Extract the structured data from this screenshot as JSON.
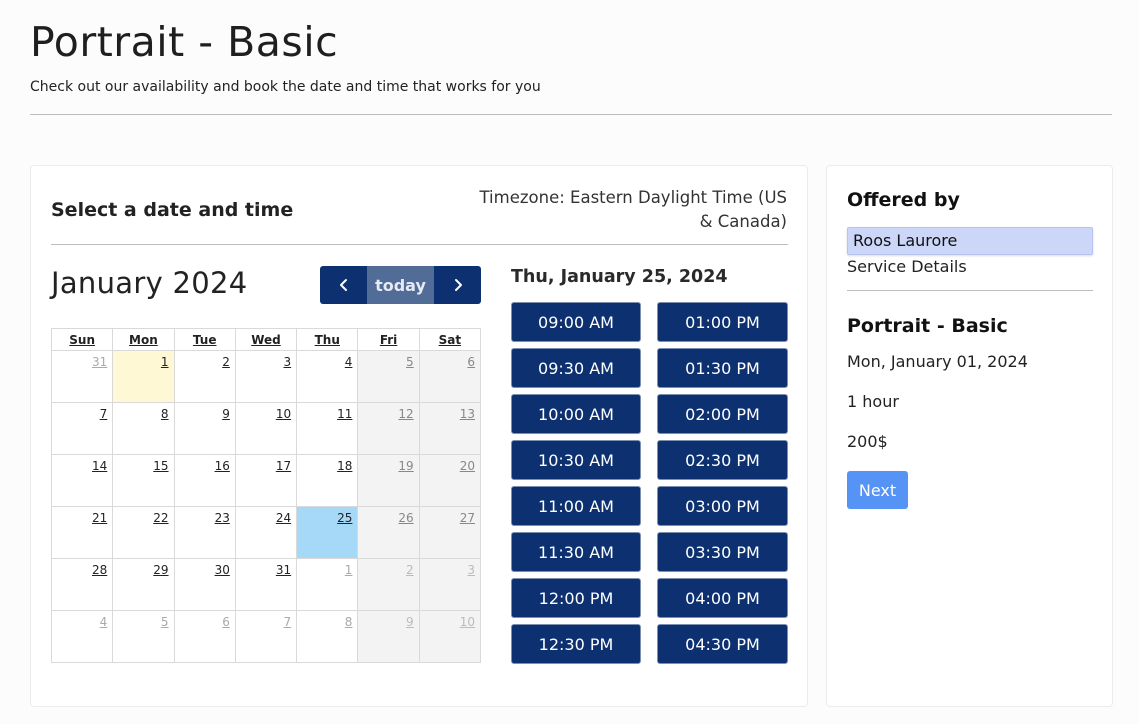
{
  "header": {
    "title": "Portrait - Basic",
    "subtitle": "Check out our availability and book the date and time that works for you"
  },
  "booking": {
    "heading": "Select a date and time",
    "timezone": "Timezone: Eastern Daylight Time (US & Canada)",
    "calendar": {
      "month_title": "January 2024",
      "prev_icon": "chevron-left-icon",
      "next_icon": "chevron-right-icon",
      "today_label": "today",
      "weekdays": [
        "Sun",
        "Mon",
        "Tue",
        "Wed",
        "Thu",
        "Fri",
        "Sat"
      ],
      "weeks": [
        [
          "31",
          "1",
          "2",
          "3",
          "4",
          "5",
          "6"
        ],
        [
          "7",
          "8",
          "9",
          "10",
          "11",
          "12",
          "13"
        ],
        [
          "14",
          "15",
          "16",
          "17",
          "18",
          "19",
          "20"
        ],
        [
          "21",
          "22",
          "23",
          "24",
          "25",
          "26",
          "27"
        ],
        [
          "28",
          "29",
          "30",
          "31",
          "1",
          "2",
          "3"
        ],
        [
          "4",
          "5",
          "6",
          "7",
          "8",
          "9",
          "10"
        ]
      ],
      "today_date": "1",
      "selected_date": "25"
    },
    "slots": {
      "heading": "Thu, January 25, 2024",
      "times": [
        "09:00 AM",
        "01:00 PM",
        "09:30 AM",
        "01:30 PM",
        "10:00 AM",
        "02:00 PM",
        "10:30 AM",
        "02:30 PM",
        "11:00 AM",
        "03:00 PM",
        "11:30 AM",
        "03:30 PM",
        "12:00 PM",
        "04:00 PM",
        "12:30 PM",
        "04:30 PM"
      ]
    }
  },
  "sidebar": {
    "offered_by_label": "Offered by",
    "provider": "Roos Laurore",
    "service_details_label": "Service Details",
    "service_name": "Portrait - Basic",
    "date": "Mon, January 01, 2024",
    "duration": "1 hour",
    "price": "200$",
    "next_label": "Next"
  },
  "colors": {
    "primary": "#0d3170",
    "today_button": "#526c98",
    "next_button": "#5593f5",
    "today_highlight": "#fff8d5",
    "selected_highlight": "#a6d9f7",
    "provider_highlight": "#cbd6f8"
  }
}
